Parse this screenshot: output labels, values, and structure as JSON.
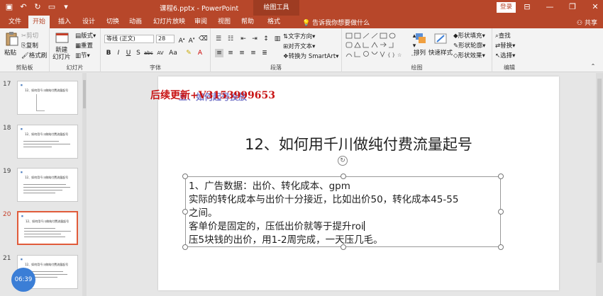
{
  "titlebar": {
    "doc_title": "课程6.pptx - PowerPoint",
    "context_tab": "绘图工具",
    "login_label": "登录",
    "icons": [
      "save-icon",
      "undo-icon",
      "redo-icon",
      "slideshow-icon",
      "customize-icon"
    ]
  },
  "tabs": [
    {
      "label": "文件"
    },
    {
      "label": "开始"
    },
    {
      "label": "插入"
    },
    {
      "label": "设计"
    },
    {
      "label": "切换"
    },
    {
      "label": "动画"
    },
    {
      "label": "幻灯片放映"
    },
    {
      "label": "审阅"
    },
    {
      "label": "视图"
    },
    {
      "label": "帮助"
    },
    {
      "label": "格式"
    }
  ],
  "active_tab": "开始",
  "tellme": "告诉我你想要做什么",
  "share": "共享",
  "ribbon": {
    "clipboard": {
      "label": "剪贴板",
      "paste": "粘贴",
      "cut": "剪切",
      "copy": "复制",
      "format_painter": "格式刷"
    },
    "slides": {
      "label": "幻灯片",
      "new_slide": "新建\n幻灯片",
      "layout": "版式",
      "reset": "重置",
      "section": "节"
    },
    "font": {
      "label": "字体",
      "font_name": "等线 (正文)",
      "font_size": "28",
      "bold": "B",
      "italic": "I",
      "underline": "U",
      "strike": "S",
      "char_spacing": "AV",
      "change_case": "Aa",
      "font_color": "A"
    },
    "paragraph": {
      "label": "段落",
      "text_direction": "文字方向",
      "align_text": "对齐文本",
      "smartart": "转换为 SmartArt"
    },
    "drawing": {
      "label": "绘图",
      "arrange": "排列",
      "quick_styles": "快速样式",
      "fill": "形状填充",
      "outline": "形状轮廓",
      "effects": "形状效果"
    },
    "editing": {
      "label": "编辑",
      "find": "查找",
      "replace": "替换",
      "select": "选择"
    }
  },
  "slides": [
    {
      "num": "17",
      "title": "12、如何用千川做纯付费流量起号"
    },
    {
      "num": "18",
      "title": "12、如何用千川做纯付费流量起号"
    },
    {
      "num": "19",
      "title": "12、如何用千川做纯付费流量起号"
    },
    {
      "num": "20",
      "title": "12、如何用千川做纯付费流量起号",
      "active": true
    },
    {
      "num": "21",
      "title": "12、如何用千川做纯付费流量起号"
    }
  ],
  "timer": "06:39",
  "main_slide": {
    "watermark_red": "后续更新+V3153999653",
    "watermark_blue": "五、如何起号投放",
    "title": "12、如何用千川做纯付费流量起号",
    "body": [
      "1、广告数据：出价、转化成本、gpm",
      "实际的转化成本与出价十分接近，比如出价50，转化成本45-55",
      "之间。",
      "客单价是固定的，压低出价就等于提升roi",
      "压5块钱的出价，用1-2周完成，一天压几毛。"
    ]
  }
}
